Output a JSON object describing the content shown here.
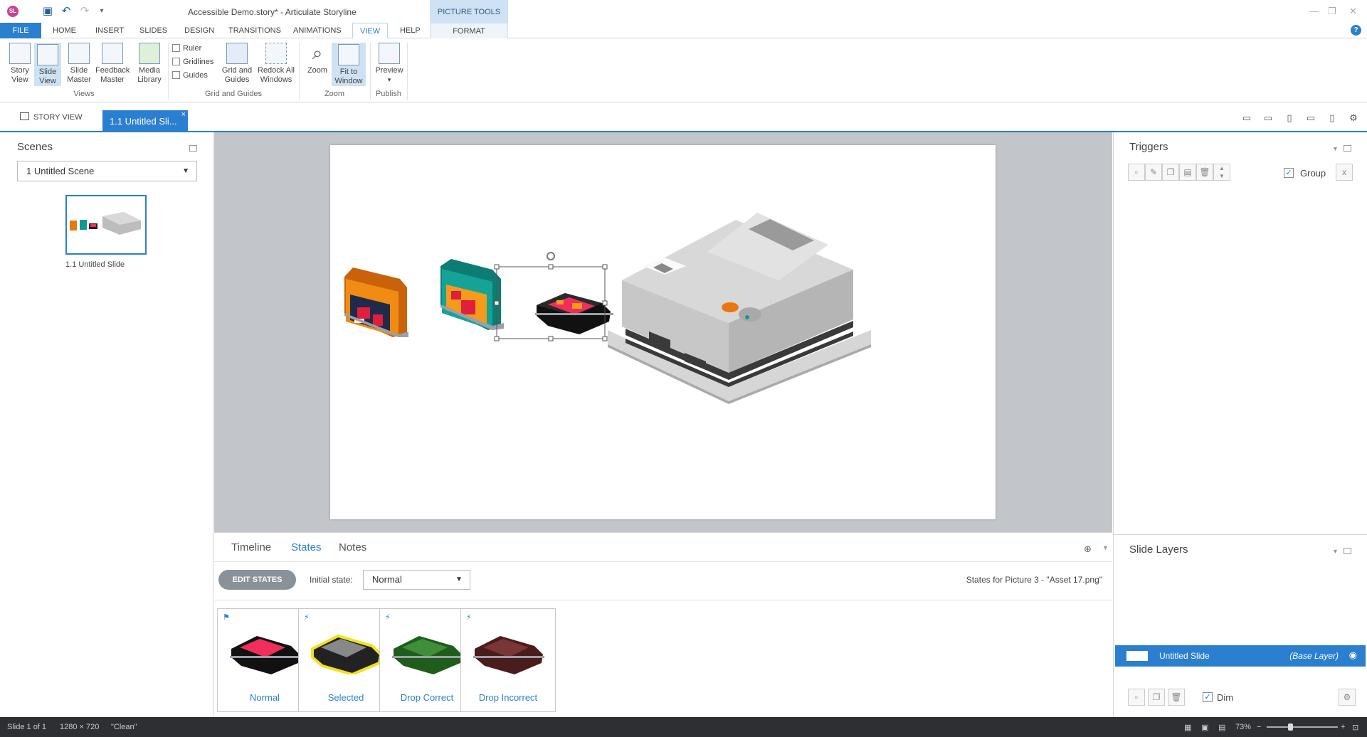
{
  "titlebar": {
    "app_logo": "SL",
    "title": "Accessible Demo.story* -  Articulate Storyline",
    "context_tab": "PICTURE TOOLS",
    "qat_icons": [
      "save-icon",
      "undo-icon",
      "redo-icon",
      "customize-icon"
    ],
    "window_controls": [
      "minimize-icon",
      "restore-icon",
      "close-icon"
    ]
  },
  "ribbon_tabs": {
    "file": "FILE",
    "tabs": [
      "HOME",
      "INSERT",
      "SLIDES",
      "DESIGN",
      "TRANSITIONS",
      "ANIMATIONS",
      "VIEW",
      "HELP"
    ],
    "format": "FORMAT",
    "help_icon": "?"
  },
  "ribbon": {
    "story_view": "Story\nView",
    "slide_view": "Slide\nView",
    "slide_master": "Slide\nMaster",
    "feedback_master": "Feedback\nMaster",
    "media_library": "Media\nLibrary",
    "views_label": "Views",
    "ruler": "Ruler",
    "gridlines": "Gridlines",
    "guides": "Guides",
    "grid_guides": "Grid and\nGuides",
    "redock": "Redock All\nWindows",
    "grid_group_label": "Grid and Guides",
    "zoom": "Zoom",
    "fit_window": "Fit to\nWindow",
    "zoom_group_label": "Zoom",
    "preview": "Preview",
    "publish_label": "Publish"
  },
  "doctabs": {
    "story_view": "STORY VIEW",
    "slide_tab": "1.1 Untitled Sli...",
    "close": "×"
  },
  "scenes": {
    "title": "Scenes",
    "selected_scene": "1 Untitled Scene",
    "slide_label": "1.1 Untitled Slide"
  },
  "bottom": {
    "tabs": [
      "Timeline",
      "States",
      "Notes"
    ],
    "edit_states": "EDIT STATES",
    "initial_label": "Initial state:",
    "initial_value": "Normal",
    "states_caption": "States for Picture 3 - \"Asset 17.png\"",
    "states": [
      {
        "label": "Normal",
        "marker": "⚑",
        "color": "#f02d5b"
      },
      {
        "label": "Selected",
        "marker": "⚡",
        "color": "#888888"
      },
      {
        "label": "Drop Correct",
        "marker": "⚡",
        "color": "#3f8f3a"
      },
      {
        "label": "Drop Incorrect",
        "marker": "⚡",
        "color": "#7a3535"
      }
    ]
  },
  "triggers": {
    "title": "Triggers",
    "group_label": "Group",
    "group_checked": "✓"
  },
  "layers": {
    "title": "Slide Layers",
    "base_name": "Untitled Slide",
    "base_tag": "(Base Layer)",
    "dim_label": "Dim",
    "dim_checked": "✓"
  },
  "status": {
    "slide": "Slide 1 of 1",
    "size": "1280 × 720",
    "theme": "\"Clean\"",
    "zoom": "73%"
  },
  "colors": {
    "accent": "#2b7fd0",
    "canvas_bg": "#c2c6cb",
    "statusbar": "#2d2f33"
  }
}
